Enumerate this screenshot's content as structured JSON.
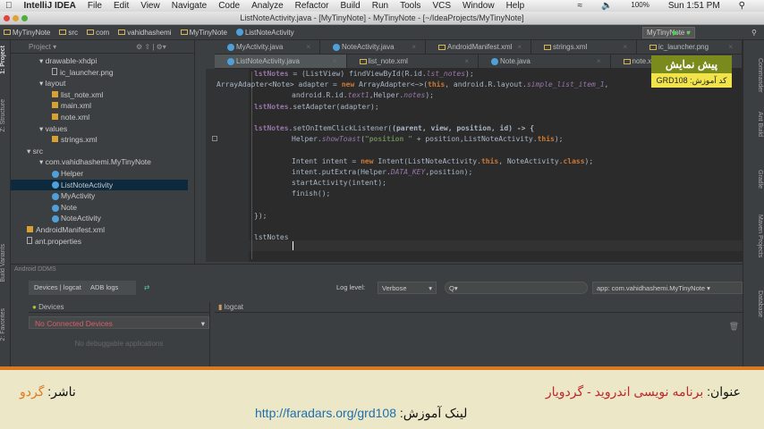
{
  "menubar": {
    "app": "IntelliJ IDEA",
    "items": [
      "File",
      "Edit",
      "View",
      "Navigate",
      "Code",
      "Analyze",
      "Refactor",
      "Build",
      "Run",
      "Tools",
      "VCS",
      "Window",
      "Help"
    ],
    "battery": "100%",
    "clock": "Sun 1:51 PM"
  },
  "window_title": "ListNoteActivity.java - [MyTinyNote] - MyTinyNote - [~/IdeaProjects/MyTinyNote]",
  "breadcrumb": [
    "MyTinyNote",
    "src",
    "com",
    "vahidhashemi",
    "MyTinyNote",
    "ListNoteActivity"
  ],
  "run_config": "MyTinyNote",
  "side_tabs": {
    "project": "1: Project",
    "structure": "Z: Structure",
    "build_variants": "Build Variants",
    "favorites": "2: Favorites",
    "commander": "Commander",
    "ant_build": "Ant Build",
    "gradle": "Gradle",
    "maven": "Maven Projects",
    "database": "Database"
  },
  "project": {
    "header": "Project",
    "tree": [
      {
        "label": "drawable-xhdpi",
        "type": "folder",
        "depth": 2
      },
      {
        "label": "ic_launcher.png",
        "type": "file",
        "depth": 3
      },
      {
        "label": "layout",
        "type": "folder",
        "depth": 2
      },
      {
        "label": "list_note.xml",
        "type": "xml",
        "depth": 3
      },
      {
        "label": "main.xml",
        "type": "xml",
        "depth": 3
      },
      {
        "label": "note.xml",
        "type": "xml",
        "depth": 3
      },
      {
        "label": "values",
        "type": "folder",
        "depth": 2
      },
      {
        "label": "strings.xml",
        "type": "xml",
        "depth": 3
      },
      {
        "label": "src",
        "type": "folder",
        "depth": 1
      },
      {
        "label": "com.vahidhashemi.MyTinyNote",
        "type": "folder",
        "depth": 2
      },
      {
        "label": "Helper",
        "type": "class",
        "depth": 3
      },
      {
        "label": "ListNoteActivity",
        "type": "class",
        "depth": 3,
        "selected": true
      },
      {
        "label": "MyActivity",
        "type": "class",
        "depth": 3
      },
      {
        "label": "Note",
        "type": "class",
        "depth": 3
      },
      {
        "label": "NoteActivity",
        "type": "class",
        "depth": 3
      },
      {
        "label": "AndroidManifest.xml",
        "type": "xml",
        "depth": 1
      },
      {
        "label": "ant.properties",
        "type": "file",
        "depth": 1
      }
    ]
  },
  "tabs_row1": [
    "MyActivity.java",
    "NoteActivity.java",
    "AndroidManifest.xml",
    "strings.xml",
    "ic_launcher.png"
  ],
  "tabs_row2": [
    "ListNoteActivity.java",
    "list_note.xml",
    "Note.java",
    "note.xml"
  ],
  "code": [
    {
      "indent": 0,
      "tokens": [
        [
          "lstNotes",
          "f"
        ],
        [
          " = (ListView) findViewById(R.id.",
          ""
        ],
        [
          "lst_notes",
          "i"
        ],
        [
          ");",
          ""
        ]
      ]
    },
    {
      "indent": -1,
      "tokens": [
        [
          "ArrayAdapter<Note> adapter = ",
          ""
        ],
        [
          "new",
          "k"
        ],
        [
          " ArrayAdapter<~>(",
          ""
        ],
        [
          "this",
          "k"
        ],
        [
          ", android.R.layout.",
          ""
        ],
        [
          "simple_list_item_1",
          "i"
        ],
        [
          ",",
          ""
        ]
      ]
    },
    {
      "indent": 1,
      "tokens": [
        [
          "android.R.id.",
          ""
        ],
        [
          "text1",
          "i"
        ],
        [
          ",Helper.",
          ""
        ],
        [
          "notes",
          "i"
        ],
        [
          ");",
          ""
        ]
      ]
    },
    {
      "indent": 0,
      "tokens": [
        [
          "lstNotes",
          "f"
        ],
        [
          ".setAdapter(adapter);",
          ""
        ]
      ]
    },
    {
      "indent": 0,
      "tokens": [
        [
          "",
          ""
        ]
      ]
    },
    {
      "indent": 0,
      "tokens": [
        [
          "lstNotes",
          "f"
        ],
        [
          ".setOnItemClickListener(",
          ""
        ],
        [
          "(parent, view, position, id) -> {",
          "b"
        ]
      ]
    },
    {
      "indent": 1,
      "tokens": [
        [
          "Helper.",
          ""
        ],
        [
          "showToast",
          "i"
        ],
        [
          "(",
          ""
        ],
        [
          "\"position \"",
          "s"
        ],
        [
          " + position,ListNoteActivity.",
          ""
        ],
        [
          "this",
          "k"
        ],
        [
          ");",
          ""
        ]
      ]
    },
    {
      "indent": 0,
      "tokens": [
        [
          "",
          ""
        ]
      ]
    },
    {
      "indent": 1,
      "tokens": [
        [
          "Intent intent = ",
          ""
        ],
        [
          "new",
          "k"
        ],
        [
          " Intent(ListNoteActivity.",
          ""
        ],
        [
          "this",
          "k"
        ],
        [
          ", NoteActivity.",
          ""
        ],
        [
          "class",
          "k"
        ],
        [
          ");",
          ""
        ]
      ]
    },
    {
      "indent": 1,
      "tokens": [
        [
          "intent.putExtra(Helper.",
          ""
        ],
        [
          "DATA_KEY",
          "i"
        ],
        [
          ",position);",
          ""
        ]
      ]
    },
    {
      "indent": 1,
      "tokens": [
        [
          "startActivity(intent);",
          ""
        ]
      ]
    },
    {
      "indent": 1,
      "tokens": [
        [
          "finish();",
          ""
        ]
      ]
    },
    {
      "indent": 0,
      "tokens": [
        [
          "",
          ""
        ]
      ]
    },
    {
      "indent": 0,
      "tokens": [
        [
          "});",
          ""
        ]
      ]
    },
    {
      "indent": 0,
      "tokens": [
        [
          "",
          ""
        ]
      ]
    },
    {
      "indent": 0,
      "tokens": [
        [
          "lstNotes",
          ""
        ]
      ]
    }
  ],
  "overlay": {
    "title": "پیش نمایش",
    "code": "کد آموزش: GRD108"
  },
  "ddms": {
    "title": "Android DDMS",
    "devices_tab": "Devices | logcat",
    "adb_tab": "ADB logs",
    "log_level_label": "Log level:",
    "log_level": "Verbose",
    "search_placeholder": "Q▾",
    "app_filter": "app: com.vahidhashemi.MyTinyNote",
    "devices_header": "Devices",
    "no_devices": "No Connected Devices",
    "no_apps": "No debuggable applications",
    "logcat_header": "logcat"
  },
  "banner": {
    "title_label": "عنوان:",
    "title": "برنامه نویسی اندروید - گردویار",
    "publisher_label": "ناشر:",
    "publisher": "گردو",
    "link_label": "لینک آموزش:",
    "link": "http://faradars.org/grd108"
  }
}
